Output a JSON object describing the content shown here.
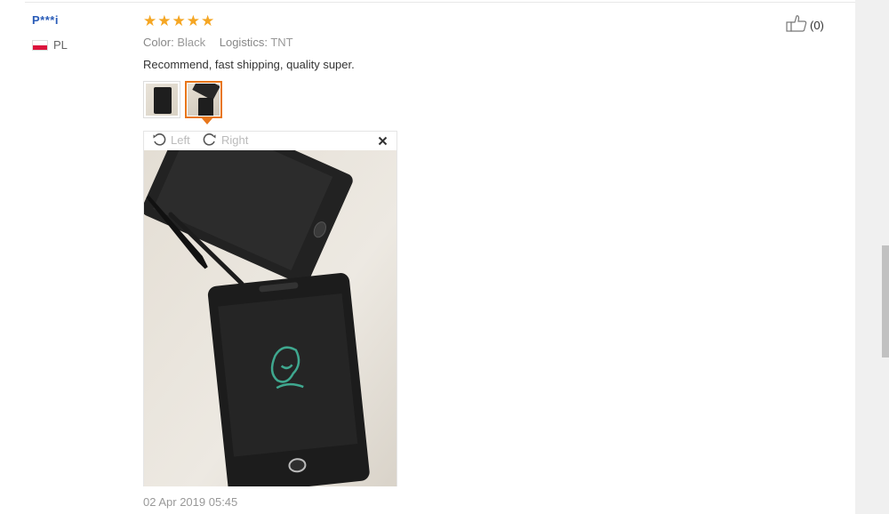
{
  "review": {
    "user_name": "P***i",
    "country_code": "PL",
    "rating": 5,
    "stars": [
      "★",
      "★",
      "★",
      "★",
      "★"
    ],
    "star_color": "#f5a623",
    "attributes": [
      {
        "label": "Color:",
        "value": "Black"
      },
      {
        "label": "Logistics:",
        "value": "TNT"
      }
    ],
    "text": "Recommend, fast shipping, quality super.",
    "thumbnail_count": 2,
    "selected_thumbnail": 2,
    "date": "02 Apr 2019 05:45"
  },
  "viewer": {
    "rotate_left_label": "Left",
    "rotate_right_label": "Right",
    "close_icon": "close-icon",
    "rotate_left_icon": "rotate-left-icon",
    "rotate_right_icon": "rotate-right-icon"
  },
  "helpful": {
    "icon": "thumbs-up-icon",
    "count_label": "(0)"
  },
  "colors": {
    "user_link": "#2a5cb8",
    "selected_border": "#e8761a",
    "muted_text": "#999999"
  }
}
